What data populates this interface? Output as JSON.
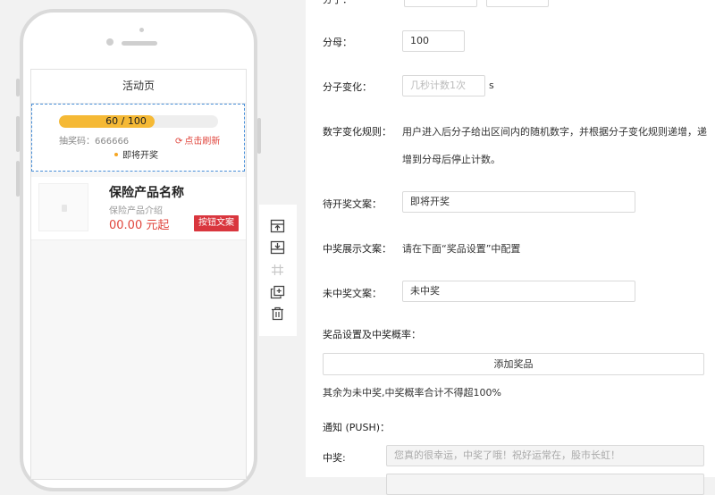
{
  "phone": {
    "page_title": "活动页",
    "lottery": {
      "current": 60,
      "total": 100,
      "progress_text": "60 / 100",
      "progress_fraction": 0.6,
      "code_label": "抽奖码：666666",
      "refresh_label": "点击刷新",
      "status_label": "即将开奖"
    },
    "product": {
      "name": "保险产品名称",
      "desc": "保险产品介绍",
      "price": "00.00 元起",
      "button_label": "按钮文案"
    }
  },
  "toolbar": {
    "icons": [
      "move-up-icon",
      "move-down-icon",
      "grid-icon",
      "copy-icon",
      "trash-icon"
    ]
  },
  "form": {
    "denominator_label": "分母：",
    "denominator_value": "100",
    "numerator_change_label": "分子变化：",
    "numerator_change_placeholder": "几秒计数1次",
    "numerator_change_unit": "s",
    "rule_label": "数字变化规则：",
    "rule_text_line1": "用户进入后分子给出区间内的随机数字，并根据分子变化规则递增，递",
    "rule_text_line2": "增到分母后停止计数。",
    "pending_text_label": "待开奖文案：",
    "pending_text_value": "即将开奖",
    "win_display_label": "中奖展示文案：",
    "win_display_value": "请在下面“奖品设置”中配置",
    "lose_text_label": "未中奖文案：",
    "lose_text_value": "未中奖",
    "prize_settings_label": "奖品设置及中奖概率：",
    "add_prize_label": "添加奖品",
    "prize_note": "其余为未中奖,中奖概率合计不得超100%",
    "push_label": "通知 (PUSH)：",
    "win_push_label": "中奖:",
    "win_push_placeholder": "您真的很幸运，中奖了哦！祝好运常在，股市长虹！"
  },
  "colors": {
    "accent_red": "#d9363e",
    "progress_orange": "#f5b935",
    "selection_blue": "#4a90d9"
  }
}
